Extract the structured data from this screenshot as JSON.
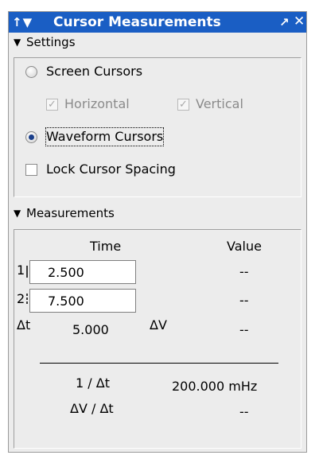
{
  "titlebar": {
    "pin_icon": "↑",
    "collapse_icon": "▼",
    "title": "Cursor Measurements",
    "undock_icon": "↗",
    "close_icon": "✕"
  },
  "settings": {
    "header": "Settings",
    "screen_cursors": "Screen Cursors",
    "horizontal": "Horizontal",
    "vertical": "Vertical",
    "waveform_cursors": "Waveform Cursors",
    "lock_spacing": "Lock Cursor Spacing",
    "screen_cursors_selected": false,
    "waveform_cursors_selected": true,
    "horizontal_checked": true,
    "vertical_checked": true,
    "lock_spacing_checked": false
  },
  "measurements": {
    "header": "Measurements",
    "col_time": "Time",
    "col_value": "Value",
    "row1_label": "1",
    "row1_time": "2.500",
    "row1_value": "--",
    "row2_label": "2",
    "row2_time": "7.500",
    "row2_value": "--",
    "dt_label": "Δt",
    "dt_value": "5.000",
    "dv_label": "ΔV",
    "dv_value": "--",
    "inv_dt_label": "1 / Δt",
    "inv_dt_value": "200.000 mHz",
    "dv_dt_label": "ΔV / Δt",
    "dv_dt_value": "--"
  }
}
